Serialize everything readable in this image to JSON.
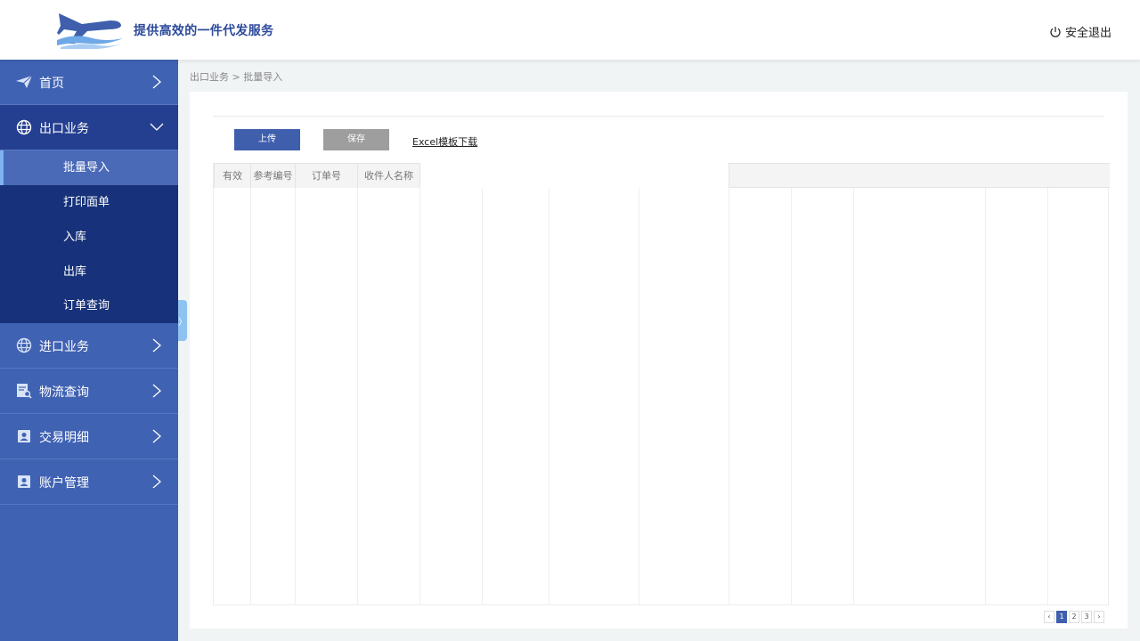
{
  "header": {
    "slogan": "提供高效的一件代发服务",
    "logout_label": "安全退出"
  },
  "sidebar": {
    "items": [
      {
        "label": "首页",
        "icon": "paper-plane-icon"
      },
      {
        "label": "出口业务",
        "icon": "globe-icon",
        "expanded": true,
        "children": [
          "批量导入",
          "打印面单",
          "入库",
          "出库",
          "订单查询"
        ]
      },
      {
        "label": "进口业务",
        "icon": "globe-icon"
      },
      {
        "label": "物流查询",
        "icon": "document-search-icon"
      },
      {
        "label": "交易明细",
        "icon": "contact-card-icon"
      },
      {
        "label": "账户管理",
        "icon": "contact-card-icon"
      }
    ],
    "selected_child": "批量导入"
  },
  "breadcrumb": "出口业务 > 批量导入",
  "toolbar": {
    "upload_label": "上传",
    "save_label": "保存",
    "download_label": "Excel模板下载"
  },
  "table": {
    "columns": [
      "有效",
      "参考编号",
      "订单号",
      "收件人名称"
    ]
  },
  "pagination": {
    "prev": "‹",
    "pages": [
      "1",
      "2",
      "3"
    ],
    "current": "1",
    "next": "›"
  },
  "colors": {
    "primary": "#3f5fad",
    "sidebar": "#4062b3",
    "sidebar_submenu": "#17327a"
  }
}
